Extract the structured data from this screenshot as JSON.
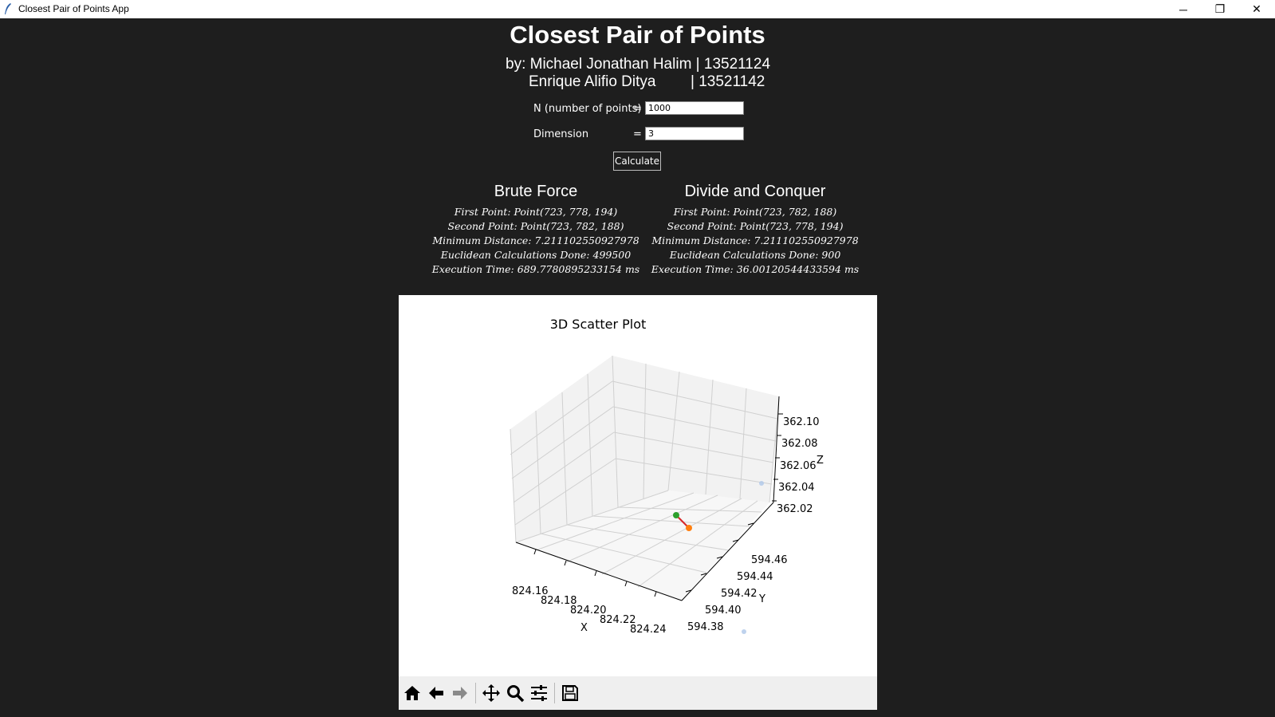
{
  "window": {
    "title": "Closest Pair of Points App",
    "minimize": "─",
    "maximize": "❐",
    "close": "✕"
  },
  "header": {
    "title": "Closest Pair of Points",
    "author1": "by: Michael Jonathan Halim | 13521124",
    "author2_name": "Enrique Alifio Ditya",
    "author2_id": "| 13521142"
  },
  "form": {
    "n_label": "N (number of points)",
    "n_eq": "=",
    "n_value": "1000",
    "dim_label": "Dimension",
    "dim_eq": "=",
    "dim_value": "3",
    "calculate_label": "Calculate"
  },
  "brute": {
    "heading": "Brute Force",
    "first_point": "First Point: Point(723, 778, 194)",
    "second_point": "Second Point: Point(723, 782, 188)",
    "min_distance": "Minimum Distance: 7.211102550927978",
    "calculations": "Euclidean Calculations Done: 499500",
    "time": "Execution Time: 689.7780895233154 ms"
  },
  "dnc": {
    "heading": "Divide and Conquer",
    "first_point": "First Point: Point(723, 782, 188)",
    "second_point": "Second Point: Point(723, 778, 194)",
    "min_distance": "Minimum Distance: 7.211102550927978",
    "calculations": "Euclidean Calculations Done: 900",
    "time": "Execution Time: 36.00120544433594 ms"
  },
  "plot": {
    "title": "3D Scatter Plot",
    "xlabel": "X",
    "ylabel": "Y",
    "zlabel": "Z",
    "x_ticks": [
      "824.16",
      "824.18",
      "824.20",
      "824.22",
      "824.24"
    ],
    "y_ticks": [
      "594.38",
      "594.40",
      "594.42",
      "594.44",
      "594.46"
    ],
    "z_ticks": [
      "362.02",
      "362.04",
      "362.06",
      "362.08",
      "362.10"
    ],
    "pair_colors": {
      "first": "#2ca02c",
      "second": "#ff7f0e",
      "line": "#d62728",
      "other": "#aec7e8"
    }
  },
  "toolbar": {
    "tools": [
      "home-icon",
      "back-icon",
      "forward-icon",
      "pan-icon",
      "zoom-icon",
      "configure-icon",
      "save-icon"
    ]
  }
}
